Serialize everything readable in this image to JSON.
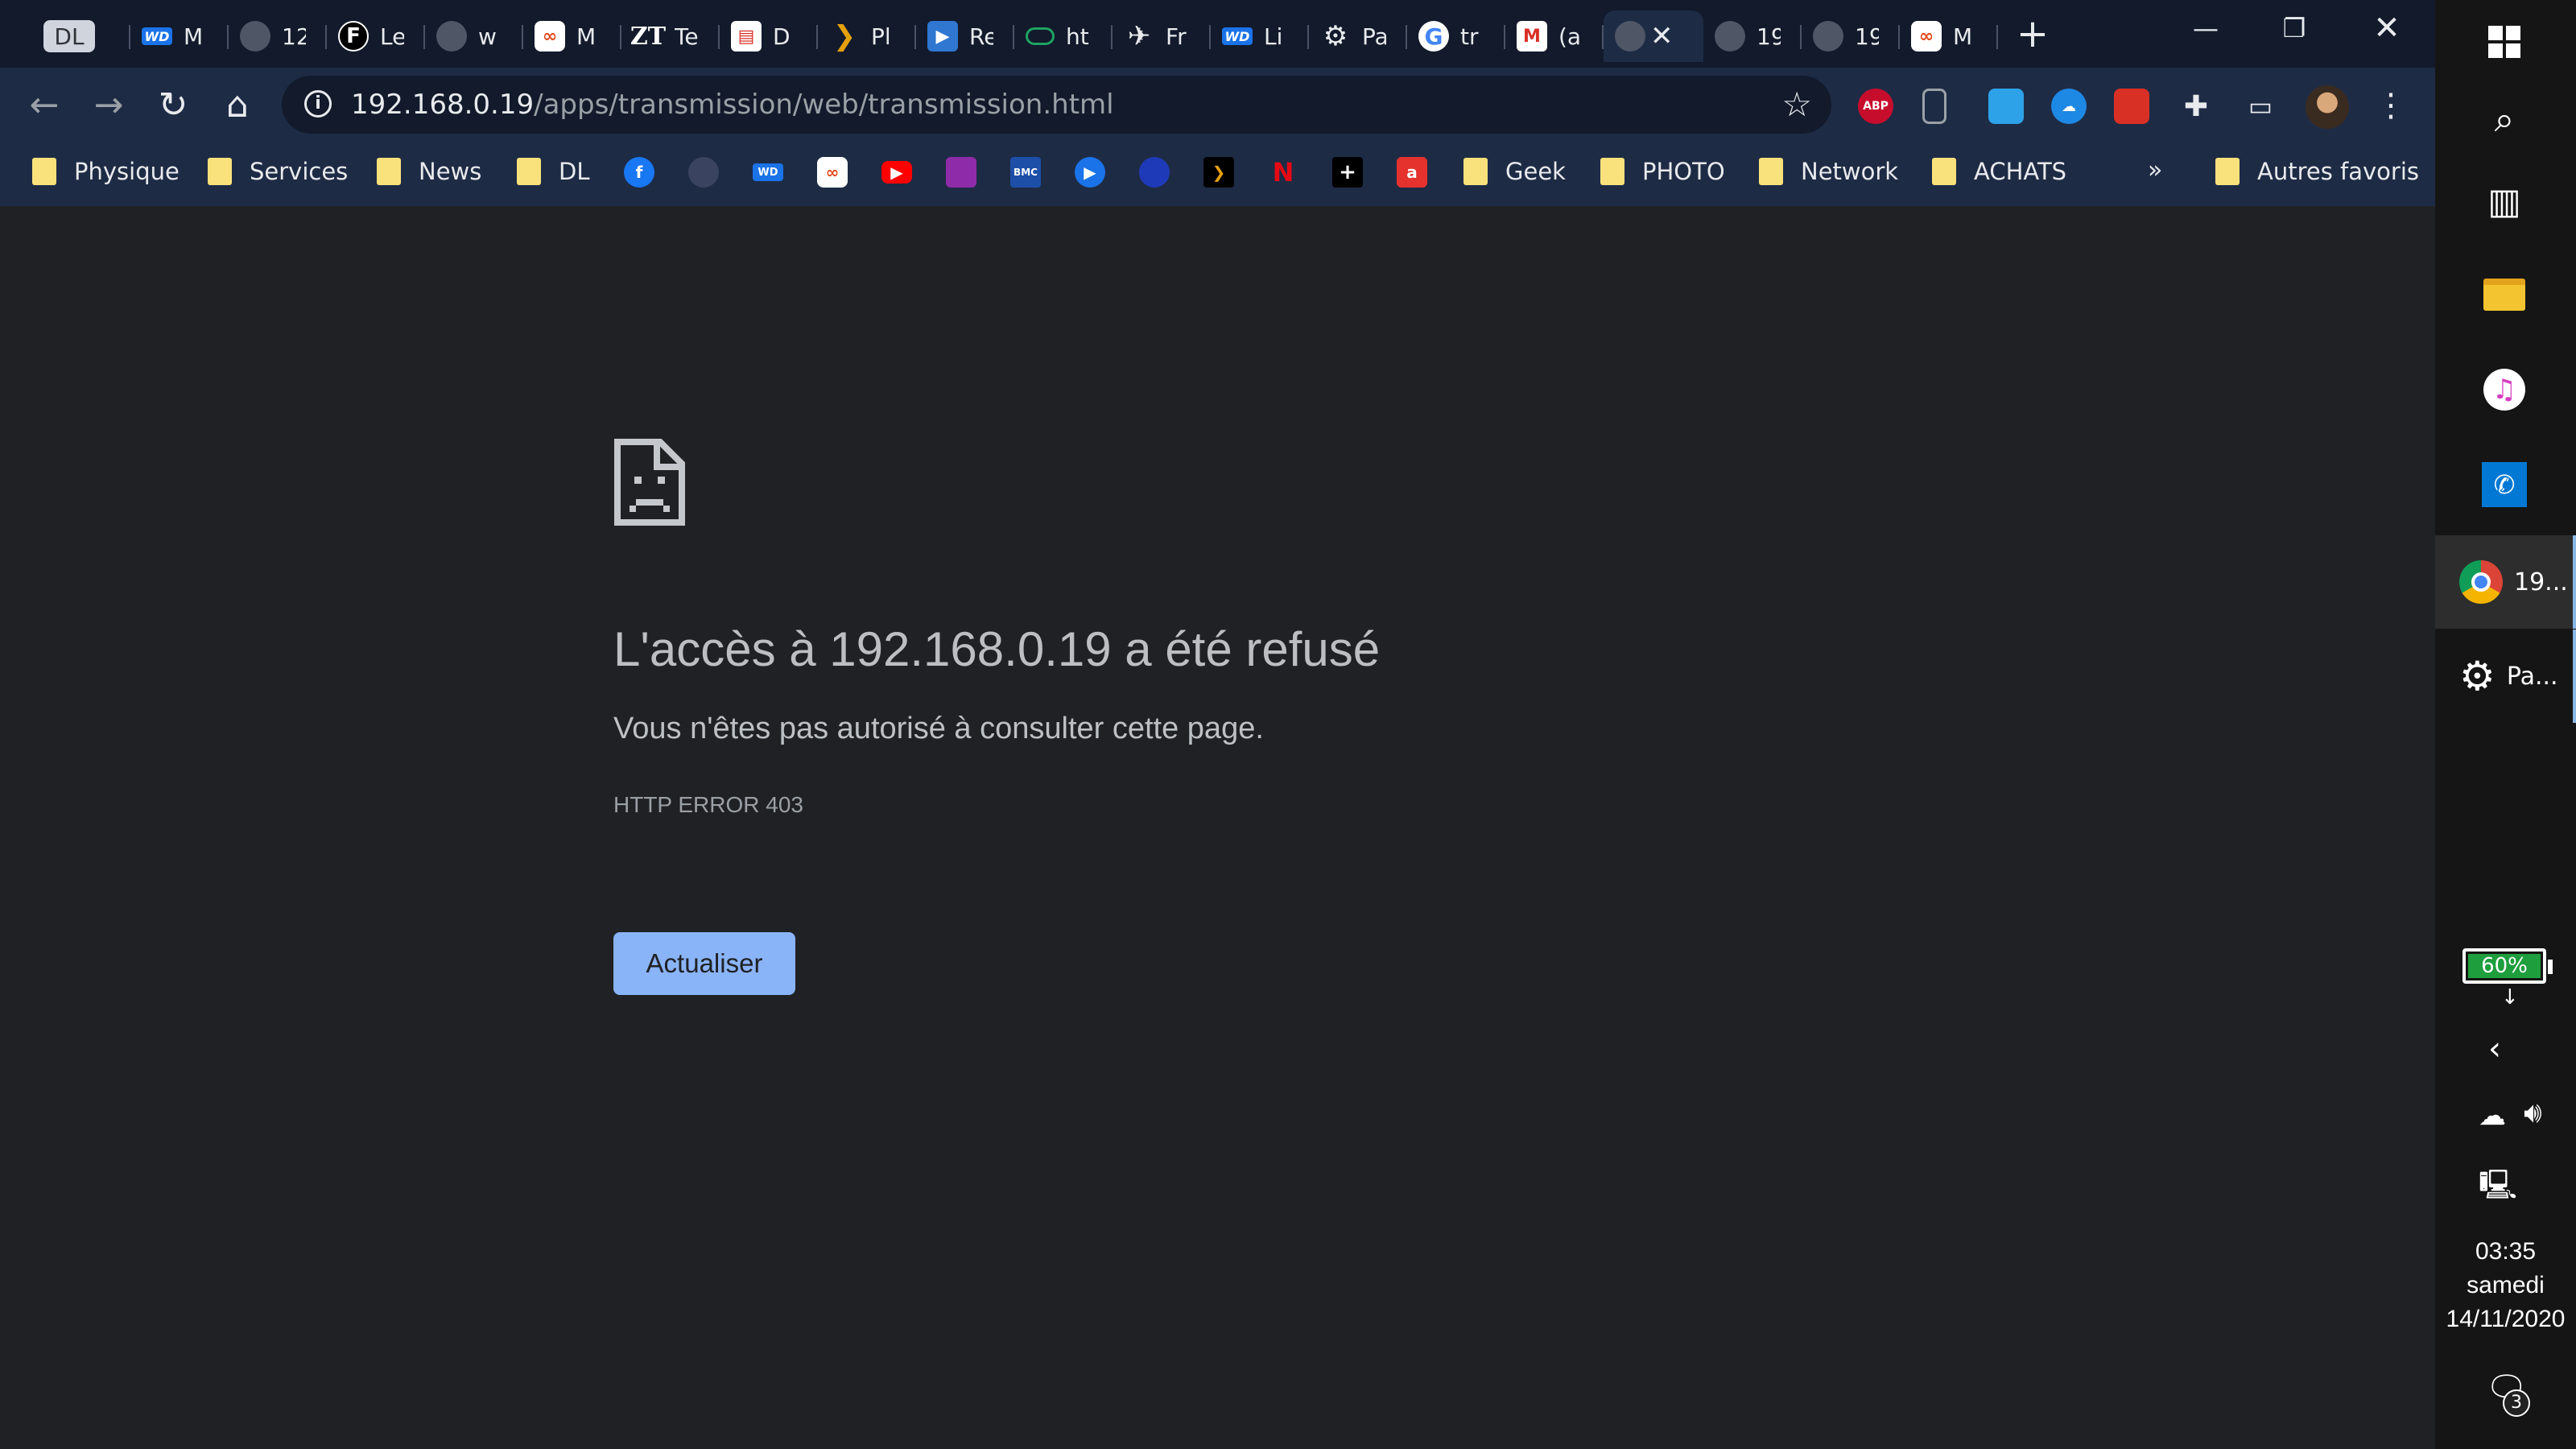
{
  "tabs": [
    {
      "label": "",
      "icon": "DL"
    },
    {
      "label": "M",
      "icon": "wd-icon"
    },
    {
      "label": "12",
      "icon": "globe-icon"
    },
    {
      "label": "Le",
      "icon": "f-icon"
    },
    {
      "label": "w",
      "icon": "globe-icon"
    },
    {
      "label": "M",
      "icon": "free-icon"
    },
    {
      "label": "Te",
      "icon": "zt-icon"
    },
    {
      "label": "D",
      "icon": "doc-icon"
    },
    {
      "label": "Pl",
      "icon": "plex-icon"
    },
    {
      "label": "Re",
      "icon": "play-icon"
    },
    {
      "label": "ht",
      "icon": "wd-green-icon"
    },
    {
      "label": "Fr",
      "icon": "plane-icon"
    },
    {
      "label": "Li",
      "icon": "wd-icon"
    },
    {
      "label": "Pa",
      "icon": "gear-icon"
    },
    {
      "label": "tr",
      "icon": "google-icon"
    },
    {
      "label": "(a",
      "icon": "gmail-icon"
    },
    {
      "label": "",
      "icon": "globe-icon",
      "active": true
    },
    {
      "label": "19",
      "icon": "globe-icon"
    },
    {
      "label": "19",
      "icon": "globe-icon"
    },
    {
      "label": "M",
      "icon": "free-icon"
    }
  ],
  "toolbar": {
    "url_host": "192.168.0.19",
    "url_path": "/apps/transmission/web/transmission.html",
    "abp_label": "ABP"
  },
  "bookmarks": {
    "items": [
      "Physique",
      "Services",
      "News",
      "DL",
      "Geek",
      "PHOTO",
      "Network",
      "ACHATS"
    ],
    "other": "Autres favoris",
    "overflow": "»"
  },
  "error": {
    "title": "L'accès à 192.168.0.19 a été refusé",
    "message": "Vous n'êtes pas autorisé à consulter cette page.",
    "code": "HTTP ERROR 403",
    "button": "Actualiser"
  },
  "taskbar": {
    "chrome_label": "19...",
    "settings_label": "Pa...",
    "battery": "60%",
    "time": "03:35",
    "day": "samedi",
    "date": "14/11/2020",
    "notifications": "3"
  },
  "colors": {
    "page_bg": "#202124",
    "toolbar": "#1e2b45",
    "tabstrip": "#121a2b",
    "button": "#8ab4f8"
  }
}
